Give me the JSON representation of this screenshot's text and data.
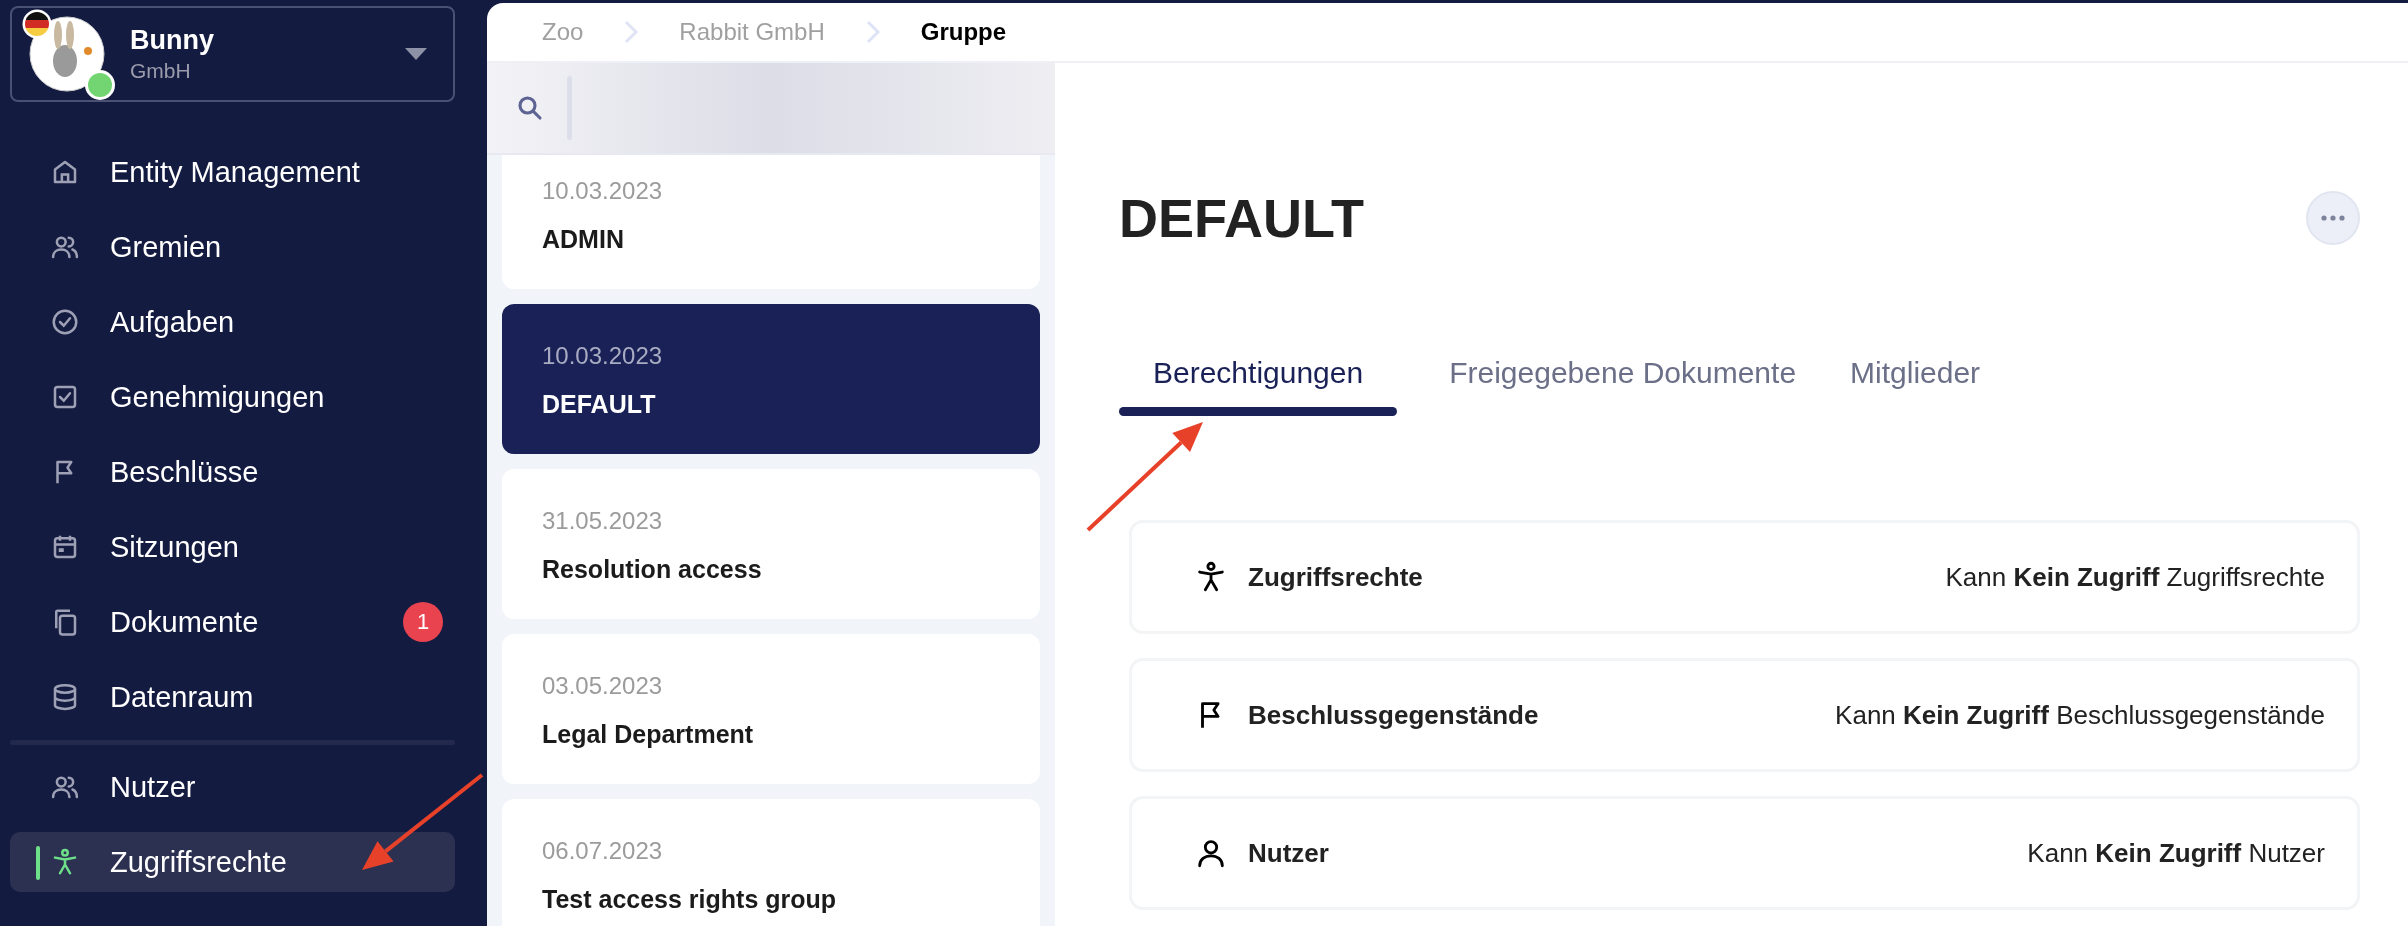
{
  "org": {
    "name": "Bunny",
    "type": "GmbH",
    "online": true
  },
  "nav": [
    {
      "label": "Entity Management",
      "selected": false
    },
    {
      "label": "Gremien",
      "selected": false
    },
    {
      "label": "Aufgaben",
      "selected": false
    },
    {
      "label": "Genehmigungen",
      "selected": false
    },
    {
      "label": "Beschlüsse",
      "selected": false
    },
    {
      "label": "Sitzungen",
      "selected": false
    },
    {
      "label": "Dokumente",
      "selected": false,
      "badge": "1"
    },
    {
      "label": "Datenraum",
      "selected": false
    }
  ],
  "nav_secondary": [
    {
      "label": "Nutzer",
      "selected": false
    },
    {
      "label": "Zugriffsrechte",
      "selected": true
    }
  ],
  "breadcrumb": [
    {
      "label": "Zoo",
      "selected": false
    },
    {
      "label": "Rabbit GmbH",
      "selected": false
    },
    {
      "label": "Gruppe",
      "selected": true
    }
  ],
  "groups": [
    {
      "date": "10.03.2023",
      "name": "ADMIN",
      "selected": false
    },
    {
      "date": "10.03.2023",
      "name": "DEFAULT",
      "selected": true
    },
    {
      "date": "31.05.2023",
      "name": "Resolution access",
      "selected": false
    },
    {
      "date": "03.05.2023",
      "name": "Legal Department",
      "selected": false
    },
    {
      "date": "06.07.2023",
      "name": "Test access rights group",
      "selected": false
    }
  ],
  "detail": {
    "title": "DEFAULT",
    "tabs": [
      {
        "label": "Berechtigungen",
        "selected": true
      },
      {
        "label": "Freigegebene Dokumente",
        "selected": false
      },
      {
        "label": "Mitglieder",
        "selected": false
      }
    ],
    "permissions": [
      {
        "name": "Zugriffsrechte",
        "summary": "Kann **Kein Zugriff** Zugriffsrechte"
      },
      {
        "name": "Beschlussgegenstände",
        "summary": "Kann **Kein Zugriff** Beschlussgegenstände"
      },
      {
        "name": "Nutzer",
        "summary": "Kann **Kein Zugriff** Nutzer"
      }
    ]
  },
  "annotations": [
    {
      "kind": "arrow"
    },
    {
      "kind": "arrow"
    }
  ]
}
